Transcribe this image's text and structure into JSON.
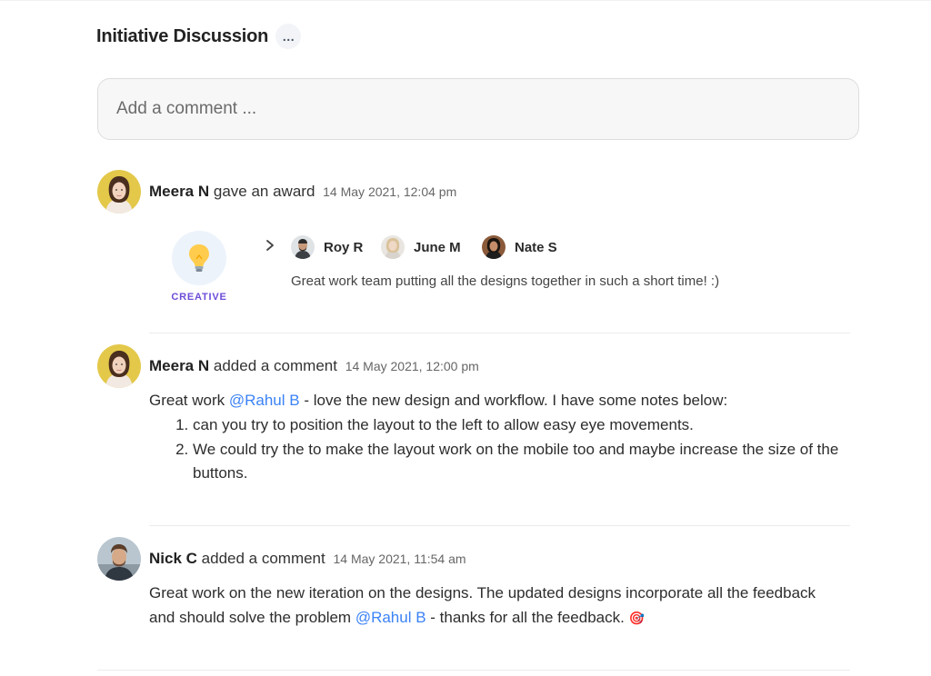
{
  "header": {
    "title": "Initiative Discussion",
    "more_label": "…"
  },
  "composer": {
    "placeholder": "Add a comment ..."
  },
  "award_activity": {
    "author": "Meera N",
    "action": "gave an award",
    "timestamp": "14 May 2021, 12:04 pm",
    "award_name": "CREATIVE",
    "recipients": [
      {
        "name": "Roy R"
      },
      {
        "name": "June M"
      },
      {
        "name": "Nate S"
      }
    ],
    "message": "Great work team putting all the designs together in such a short time! :)"
  },
  "comment_1": {
    "author": "Meera N",
    "action": "added a comment",
    "timestamp": "14 May 2021, 12:00 pm",
    "text_before": "Great work ",
    "mention": "@Rahul B",
    "text_after": " - love the new design and workflow. I have some notes below:",
    "notes": [
      "can you try to position the layout to the left to allow easy eye movements.",
      "We could try the to make the layout work on the mobile too and maybe increase the size of the buttons."
    ]
  },
  "comment_2": {
    "author": "Nick C",
    "action": "added a comment",
    "timestamp": "14 May 2021, 11:54 am",
    "text_before": "Great work on the new iteration on the designs. The updated designs incorporate all the feedback and should solve the problem ",
    "mention": "@Rahul B",
    "text_after": " - thanks for all the feedback.",
    "emoji": "🎯"
  },
  "colors": {
    "mention": "#3b82f6",
    "award_label": "#6d4cd8",
    "award_bg": "#edf3fb"
  }
}
